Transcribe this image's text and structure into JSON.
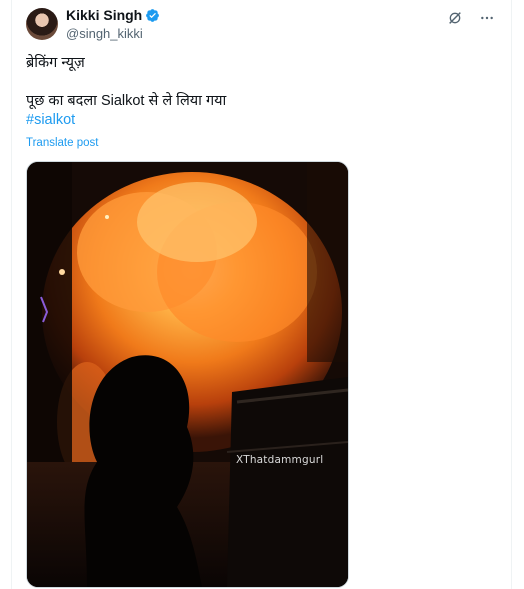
{
  "tweet": {
    "author_name": "Kikki Singh",
    "handle": "@singh_kikki",
    "line1": "ब्रेकिंग न्यूज़",
    "line2": "पूछ का बदला Sialkot से ले लिया गया",
    "hashtag": "#sialkot",
    "translate_label": "Translate post"
  },
  "media": {
    "watermark": "XThatdammgurl"
  },
  "icons": {
    "verified": "verified-badge-icon",
    "grok": "grok-icon",
    "more": "more-icon"
  },
  "colors": {
    "accent": "#1d9bf0",
    "text": "#0f1419",
    "secondary": "#536471"
  }
}
